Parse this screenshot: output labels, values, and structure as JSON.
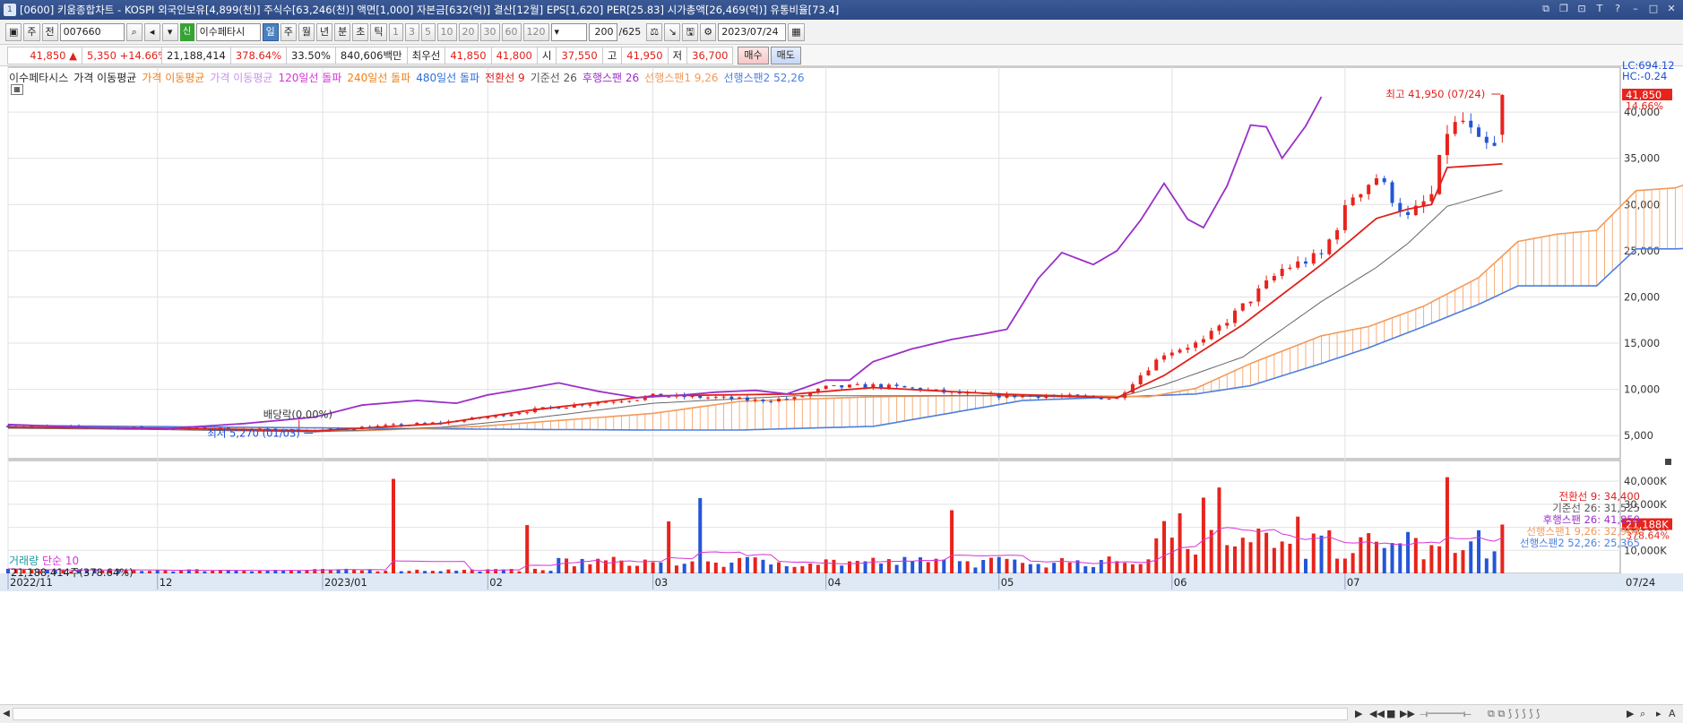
{
  "window": {
    "title": "[0600] 키움종합차트 - KOSPI 외국인보유[4,899(천)] 주식수[63,246(천)] 액면[1,000] 자본금[632(억)] 결산[12월] EPS[1,620] PER[25.83] 시가총액[26,469(억)] 유통비율[73.4]",
    "icon_label": "1"
  },
  "toolbar": {
    "market_select": "주",
    "view_select": "전",
    "stock_code": "007660",
    "badge": "신",
    "stock_name": "이수페타시",
    "periods": [
      "일",
      "주",
      "월",
      "년",
      "분",
      "초",
      "틱"
    ],
    "active_period": "일",
    "minute_options": [
      "1",
      "3",
      "5",
      "10",
      "20",
      "30",
      "60",
      "120"
    ],
    "count": "200",
    "total": "/625",
    "date": "2023/07/24"
  },
  "quote": {
    "price": "41,850 ▲",
    "change": "5,350",
    "change_pct": "+14.66%",
    "volume": "21,188,414",
    "vol_ratio": "378.64%",
    "turnover": "33.50%",
    "amount": "840,606백만",
    "best_label": "최우선",
    "best_sell": "41,850",
    "best_buy": "41,800",
    "open_label": "시",
    "open": "37,550",
    "high_label": "고",
    "high": "41,950",
    "low_label": "저",
    "low": "36,700",
    "buy_button": "매수",
    "sell_button": "매도"
  },
  "legend": [
    {
      "text": "이수페타시스",
      "color": "#333333"
    },
    {
      "text": "가격 이동평균",
      "color": "#222222"
    },
    {
      "text": "가격 이동평균",
      "color": "#f07f1a"
    },
    {
      "text": "가격 이동평균",
      "color": "#c792ea"
    },
    {
      "text": "120일선 돌파",
      "color": "#d633d6"
    },
    {
      "text": "240일선 돌파",
      "color": "#f07f1a"
    },
    {
      "text": "480일선 돌파",
      "color": "#2c6fd8"
    },
    {
      "text": "전환선 9",
      "color": "#e0201a"
    },
    {
      "text": "기준선 26",
      "color": "#555555"
    },
    {
      "text": "후행스팬 26",
      "color": "#9b2fc9"
    },
    {
      "text": "선행스팬1 9,26",
      "color": "#f39a5a"
    },
    {
      "text": "선행스팬2 52,26",
      "color": "#4d7fe0"
    }
  ],
  "right_info": {
    "lc": "LC:694.12",
    "hc": "HC:-0.24",
    "last_price": "41,850",
    "last_pct": "14.66%",
    "vol_last": "21,188K",
    "vol_pct": "378.64%"
  },
  "annotations": {
    "high": "최고 41,950 (07/24)",
    "low": "최저 5,270 (01/03)",
    "dividend": "배당락(0.00%)"
  },
  "ichimoku_values": [
    {
      "text": "전환선 9: 34,400",
      "color": "#e0201a"
    },
    {
      "text": "기준선 26: 31,525",
      "color": "#555555"
    },
    {
      "text": "후행스팬 26: 41,850",
      "color": "#9b2fc9"
    },
    {
      "text": "선행스팬1 9,26: 32,963",
      "color": "#f39a5a"
    },
    {
      "text": "선행스팬2 52,26: 25,365",
      "color": "#4d7fe0"
    }
  ],
  "volume_panel": {
    "legend_name": "거래량",
    "legend_ma": "단순 10",
    "current": "21,188,414주(378.64%)"
  },
  "x_axis_labels": [
    "2022/11",
    "12",
    "2023/01",
    "02",
    "03",
    "04",
    "05",
    "06",
    "07"
  ],
  "x_axis_end_label": "07/24",
  "price_ticks": [
    "40,000",
    "35,000",
    "30,000",
    "25,000",
    "20,000",
    "15,000",
    "10,000",
    "5,000"
  ],
  "volume_ticks": [
    "40,000K",
    "30,000K",
    "20,000K",
    "10,000K"
  ],
  "chart_data": {
    "type": "candlestick",
    "ylim": [
      2500,
      43500
    ],
    "volume_ylim": [
      0,
      49000
    ],
    "x_range": [
      0,
      205
    ],
    "x_ticks": [
      0,
      19,
      40,
      61,
      82,
      104,
      126,
      148,
      170
    ],
    "y_ticks": [
      40000,
      35000,
      30000,
      25000,
      20000,
      15000,
      10000,
      5000
    ],
    "volume_ticks": [
      40000,
      30000,
      20000,
      10000
    ],
    "last_index": 190,
    "high_point": {
      "index": 190,
      "value": 41950
    },
    "low_point": {
      "index": 39,
      "value": 5270
    },
    "dividend_index": 37,
    "anchors": {
      "close": [
        [
          0,
          6050
        ],
        [
          10,
          5900
        ],
        [
          19,
          5800
        ],
        [
          30,
          5700
        ],
        [
          39,
          5500
        ],
        [
          45,
          5900
        ],
        [
          55,
          6400
        ],
        [
          61,
          7000
        ],
        [
          66,
          7700
        ],
        [
          70,
          8100
        ],
        [
          75,
          8600
        ],
        [
          80,
          9000
        ],
        [
          82,
          9300
        ],
        [
          86,
          9200
        ],
        [
          90,
          9100
        ],
        [
          95,
          8800
        ],
        [
          100,
          9000
        ],
        [
          104,
          10200
        ],
        [
          110,
          10400
        ],
        [
          115,
          10100
        ],
        [
          120,
          9600
        ],
        [
          126,
          9300
        ],
        [
          132,
          9300
        ],
        [
          138,
          9150
        ],
        [
          141,
          9000
        ],
        [
          143,
          10800
        ],
        [
          147,
          13900
        ],
        [
          152,
          15200
        ],
        [
          157,
          19000
        ],
        [
          162,
          23000
        ],
        [
          167,
          24500
        ],
        [
          171,
          31000
        ],
        [
          174,
          33000
        ],
        [
          178,
          28500
        ],
        [
          181,
          31000
        ],
        [
          183,
          38000
        ],
        [
          185,
          39000
        ],
        [
          187,
          36500
        ],
        [
          189,
          36000
        ],
        [
          190,
          41850
        ]
      ],
      "chikou": [
        [
          0,
          6200
        ],
        [
          10,
          5900
        ],
        [
          19,
          5700
        ],
        [
          30,
          6300
        ],
        [
          39,
          7000
        ],
        [
          45,
          8300
        ],
        [
          52,
          8800
        ],
        [
          57,
          8500
        ],
        [
          61,
          9400
        ],
        [
          66,
          10100
        ],
        [
          70,
          10700
        ],
        [
          75,
          9800
        ],
        [
          80,
          9100
        ],
        [
          86,
          9400
        ],
        [
          90,
          9700
        ],
        [
          95,
          9900
        ],
        [
          99,
          9500
        ],
        [
          104,
          11000
        ],
        [
          107,
          11000
        ],
        [
          110,
          13000
        ],
        [
          115,
          14400
        ],
        [
          120,
          15400
        ],
        [
          124,
          16000
        ],
        [
          127,
          16500
        ],
        [
          131,
          22000
        ],
        [
          134,
          24800
        ],
        [
          138,
          23500
        ],
        [
          141,
          25000
        ],
        [
          144,
          28300
        ],
        [
          147,
          32300
        ],
        [
          150,
          28400
        ],
        [
          152,
          27500
        ],
        [
          155,
          32000
        ],
        [
          158,
          38600
        ],
        [
          160,
          38400
        ],
        [
          162,
          35000
        ],
        [
          165,
          38500
        ],
        [
          167,
          41650
        ]
      ],
      "tenkan": [
        [
          0,
          5900
        ],
        [
          19,
          5800
        ],
        [
          39,
          5500
        ],
        [
          55,
          6300
        ],
        [
          66,
          7700
        ],
        [
          82,
          9300
        ],
        [
          100,
          9500
        ],
        [
          110,
          10200
        ],
        [
          126,
          9500
        ],
        [
          141,
          9100
        ],
        [
          147,
          11500
        ],
        [
          157,
          17000
        ],
        [
          167,
          23500
        ],
        [
          174,
          28500
        ],
        [
          178,
          29500
        ],
        [
          181,
          30000
        ],
        [
          183,
          34000
        ],
        [
          190,
          34400
        ]
      ],
      "kijun": [
        [
          0,
          5800
        ],
        [
          19,
          5650
        ],
        [
          39,
          5400
        ],
        [
          55,
          5900
        ],
        [
          66,
          6800
        ],
        [
          82,
          8500
        ],
        [
          100,
          9300
        ],
        [
          126,
          9300
        ],
        [
          141,
          9100
        ],
        [
          147,
          10500
        ],
        [
          157,
          13500
        ],
        [
          167,
          19500
        ],
        [
          174,
          23200
        ],
        [
          178,
          25800
        ],
        [
          183,
          29800
        ],
        [
          190,
          31525
        ]
      ],
      "span1": [
        [
          0,
          5900
        ],
        [
          24,
          5800
        ],
        [
          44,
          5500
        ],
        [
          60,
          6000
        ],
        [
          82,
          7400
        ],
        [
          93,
          8700
        ],
        [
          110,
          9200
        ],
        [
          129,
          9400
        ],
        [
          145,
          9200
        ],
        [
          151,
          10100
        ],
        [
          158,
          12800
        ],
        [
          167,
          15800
        ],
        [
          173,
          16800
        ],
        [
          180,
          19000
        ],
        [
          187,
          22100
        ],
        [
          192,
          26000
        ],
        [
          197,
          26800
        ],
        [
          202,
          27200
        ],
        [
          207,
          31500
        ],
        [
          212,
          31800
        ],
        [
          216,
          32963
        ]
      ],
      "span2": [
        [
          0,
          6100
        ],
        [
          30,
          5900
        ],
        [
          60,
          5700
        ],
        [
          82,
          5600
        ],
        [
          93,
          5600
        ],
        [
          110,
          6000
        ],
        [
          125,
          8200
        ],
        [
          129,
          8800
        ],
        [
          145,
          9300
        ],
        [
          151,
          9500
        ],
        [
          158,
          10400
        ],
        [
          167,
          12800
        ],
        [
          173,
          14500
        ],
        [
          180,
          16800
        ],
        [
          187,
          19200
        ],
        [
          192,
          21200
        ],
        [
          197,
          21200
        ],
        [
          202,
          21200
        ],
        [
          207,
          25200
        ],
        [
          212,
          25200
        ],
        [
          216,
          25365
        ]
      ]
    }
  }
}
